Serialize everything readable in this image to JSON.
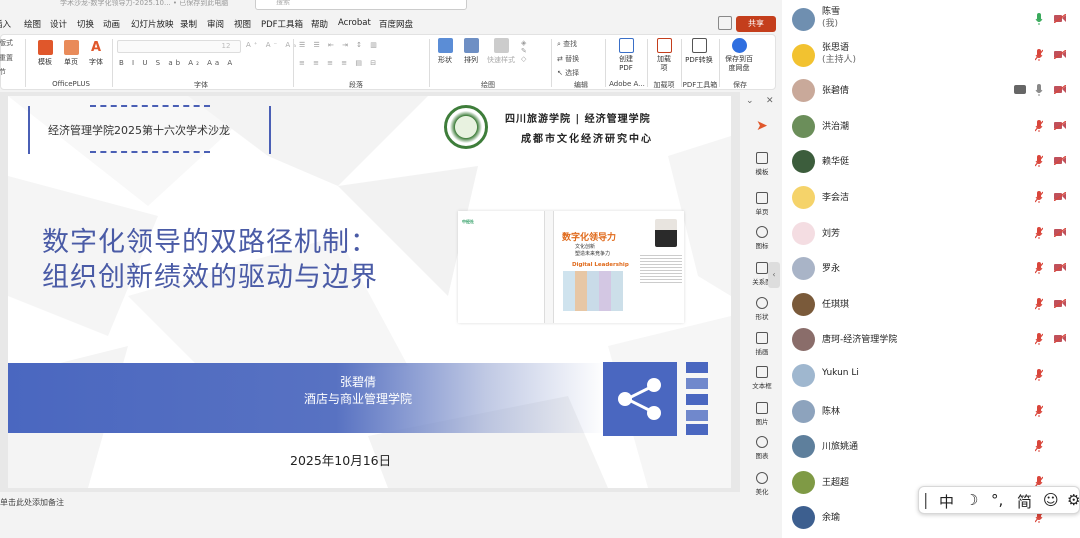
{
  "titlebar": {
    "title": "学术沙龙-数字化领导力-2025.10... • 已保存到此电脑",
    "search_placeholder": "搜索"
  },
  "menu": [
    "插入",
    "绘图",
    "设计",
    "切换",
    "动画",
    "幻灯片放映",
    "录制",
    "审阅",
    "视图",
    "PDF工具箱",
    "帮助",
    "Acrobat",
    "百度网盘"
  ],
  "share_label": "共享",
  "ribbon": {
    "officeplus": {
      "items": [
        "模板",
        "单页",
        "字体"
      ],
      "group": "OfficePLUS"
    },
    "font_group": "字体",
    "font_size": "12",
    "font_name": "",
    "paragraph_group": "段落",
    "drawing": {
      "items": [
        "形状",
        "排列",
        "快速样式"
      ],
      "group": "绘图"
    },
    "editing": {
      "items": [
        "查找",
        "替换",
        "选择"
      ],
      "group": "编辑"
    },
    "adobe": {
      "item": "创建PDF",
      "group": "Adobe A..."
    },
    "addins": {
      "item": "加载项",
      "group": "加载项"
    },
    "pdftools": {
      "item": "PDF转换",
      "group": "PDF工具箱"
    },
    "save": {
      "item": "保存到百度网盘",
      "group": "保存"
    },
    "left_items": [
      "版式",
      "重置",
      "节"
    ]
  },
  "slide": {
    "seminar": "经济管理学院2025第十六次学术沙龙",
    "school_line1": "四川旅游学院 | 经济管理学院",
    "school_line2": "成都市文化经济研究中心",
    "title_line1": "数字化领导的双路径机制：",
    "title_line2": "组织创新绩效的驱动与边界",
    "book": {
      "title": "数字化领导力",
      "subtitle1": "文化创新",
      "subtitle2": "塑造未来竞争力",
      "english": "Digital Leadership",
      "publisher": "经济管理"
    },
    "presenter": "张碧倩",
    "department": "酒店与商业管理学院",
    "date": "2025年10月16日"
  },
  "notes_placeholder": "单击此处添加备注",
  "side_panel": [
    "模板",
    "单页",
    "图标",
    "关系图",
    "形状",
    "插画",
    "文本框",
    "图片",
    "图表",
    "美化"
  ],
  "participants": [
    {
      "name": "陈雪",
      "sub": "(我)",
      "mic": "on",
      "cam": "off",
      "avatar": "#6f8fb0"
    },
    {
      "name": "张思语",
      "sub": "(主持人)",
      "mic": "off",
      "cam": "off",
      "avatar": "#f2c230"
    },
    {
      "name": "张碧倩",
      "sub": "",
      "mic": "gray",
      "cam": "share",
      "avatar": "#c9a99a"
    },
    {
      "name": "洪治潮",
      "sub": "",
      "mic": "off",
      "cam": "off",
      "avatar": "#6b8e5a"
    },
    {
      "name": "赖华侹",
      "sub": "",
      "mic": "off",
      "cam": "off",
      "avatar": "#3c5d3c"
    },
    {
      "name": "李会洁",
      "sub": "",
      "mic": "off",
      "cam": "off",
      "avatar": "#f5d36a"
    },
    {
      "name": "刘芳",
      "sub": "",
      "mic": "off",
      "cam": "off",
      "avatar": "#f4dde2"
    },
    {
      "name": "罗永",
      "sub": "",
      "mic": "off",
      "cam": "off",
      "avatar": "#a9b4c7"
    },
    {
      "name": "任琪琪",
      "sub": "",
      "mic": "off",
      "cam": "off",
      "avatar": "#7a5a3a"
    },
    {
      "name": "唐珂-经济管理学院",
      "sub": "",
      "mic": "off",
      "cam": "off",
      "avatar": "#8a6d6a"
    },
    {
      "name": "Yukun Li",
      "sub": "",
      "mic": "off",
      "cam": "none",
      "avatar": "#9fb7cf"
    },
    {
      "name": "陈林",
      "sub": "",
      "mic": "off",
      "cam": "none",
      "avatar": "#8da3bd"
    },
    {
      "name": "川旅姚通",
      "sub": "",
      "mic": "off",
      "cam": "none",
      "avatar": "#5e7f9c"
    },
    {
      "name": "王超超",
      "sub": "",
      "mic": "off",
      "cam": "none",
      "avatar": "#7f9a45"
    },
    {
      "name": "余瑜",
      "sub": "",
      "mic": "off",
      "cam": "none",
      "avatar": "#3d5f8f"
    }
  ],
  "ime": {
    "mode": "中",
    "punct": "°,",
    "script": "简"
  },
  "colors": {
    "accent": "#4a67c0",
    "mic_off": "#d9463b",
    "mic_on": "#3aaa5c",
    "share": "#c43e1c"
  }
}
